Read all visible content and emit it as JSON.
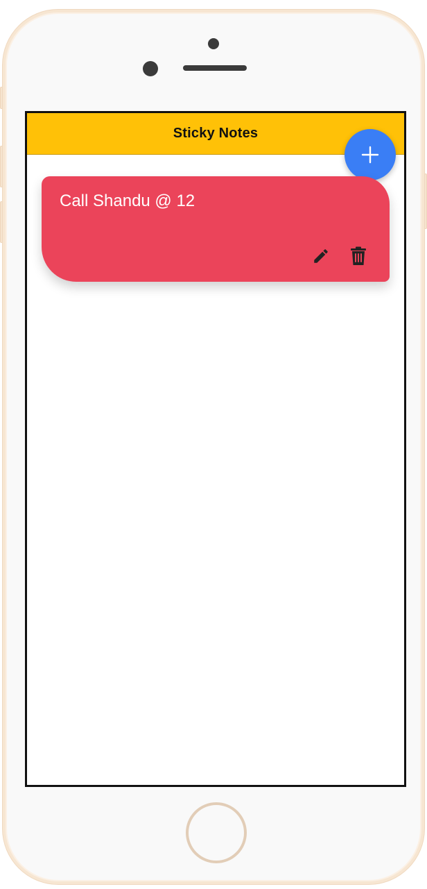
{
  "header": {
    "title": "Sticky Notes"
  },
  "fab": {
    "icon": "plus-icon"
  },
  "notes": [
    {
      "text": "Call Shandu @ 12",
      "color": "#eb445a",
      "actions": [
        {
          "icon": "pencil-icon"
        },
        {
          "icon": "trash-icon"
        }
      ]
    }
  ],
  "colors": {
    "header_bg": "#ffc107",
    "fab_bg": "#3a7ef5",
    "note_bg": "#eb445a"
  }
}
